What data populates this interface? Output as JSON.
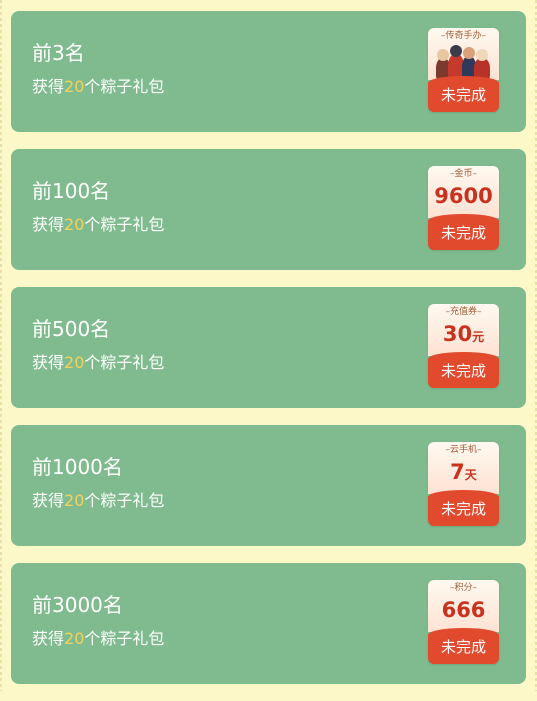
{
  "rewards": [
    {
      "rank": "前3名",
      "desc_prefix": "获得",
      "desc_count": "20",
      "desc_suffix": "个粽子礼包",
      "prize_label": "–传奇手办–",
      "prize_value": "",
      "prize_unit": "",
      "prize_image": "collectible-figures-image",
      "status": "未完成"
    },
    {
      "rank": "前100名",
      "desc_prefix": "获得",
      "desc_count": "20",
      "desc_suffix": "个粽子礼包",
      "prize_label": "–金币–",
      "prize_value": "9600",
      "prize_unit": "",
      "status": "未完成"
    },
    {
      "rank": "前500名",
      "desc_prefix": "获得",
      "desc_count": "20",
      "desc_suffix": "个粽子礼包",
      "prize_label": "–充值券–",
      "prize_value": "30",
      "prize_unit": "元",
      "status": "未完成"
    },
    {
      "rank": "前1000名",
      "desc_prefix": "获得",
      "desc_count": "20",
      "desc_suffix": "个粽子礼包",
      "prize_label": "–云手机–",
      "prize_value": "7",
      "prize_unit": "天",
      "status": "未完成"
    },
    {
      "rank": "前3000名",
      "desc_prefix": "获得",
      "desc_count": "20",
      "desc_suffix": "个粽子礼包",
      "prize_label": "–积分–",
      "prize_value": "666",
      "prize_unit": "",
      "status": "未完成"
    }
  ],
  "colors": {
    "page_background": "#fdf8c8",
    "card_background": "#80bb8f",
    "highlight_number": "#f3d25a",
    "status_background": "#e24a2e",
    "prize_value_text": "#c8321e"
  }
}
